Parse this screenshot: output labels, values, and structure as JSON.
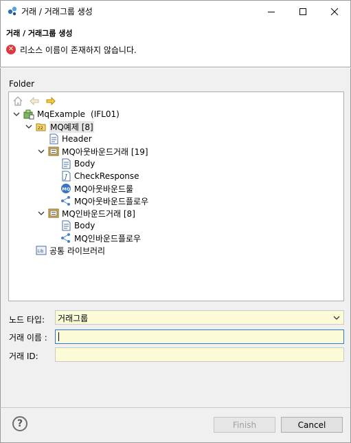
{
  "window": {
    "title": "거래 / 거래그룹 생성"
  },
  "header": {
    "title": "거래 / 거래그룹 생성",
    "error_message": "리소스 이름이 존재하지 않습니다."
  },
  "folder_label": "Folder",
  "tree": {
    "root": {
      "label": "MqExample",
      "suffix": "(IFL01)"
    },
    "group": {
      "label": "MQ예제",
      "count": "[8]"
    },
    "header_item": "Header",
    "outbound": {
      "label": "MQ아웃바운드거래",
      "count": "[19]"
    },
    "out_body": "Body",
    "out_check": "CheckResponse",
    "out_rule": "MQ아웃바운드룰",
    "out_flow": "MQ아웃바운드플로우",
    "inbound": {
      "label": "MQ인바운드거래",
      "count": "[8]"
    },
    "in_body": "Body",
    "in_flow": "MQ인바운드플로우",
    "library": "공통 라이브러리"
  },
  "form": {
    "node_type_label": "노드 타입:",
    "node_type_value": "거래그룹",
    "name_label": "거래 이름  :",
    "name_value": "",
    "id_label": "거래 ID:",
    "id_value": ""
  },
  "buttons": {
    "finish": "Finish",
    "cancel": "Cancel",
    "help": "?"
  },
  "colors": {
    "field_bg": "#fbfbd8",
    "error": "#e0383a",
    "focus": "#2a78d7"
  }
}
